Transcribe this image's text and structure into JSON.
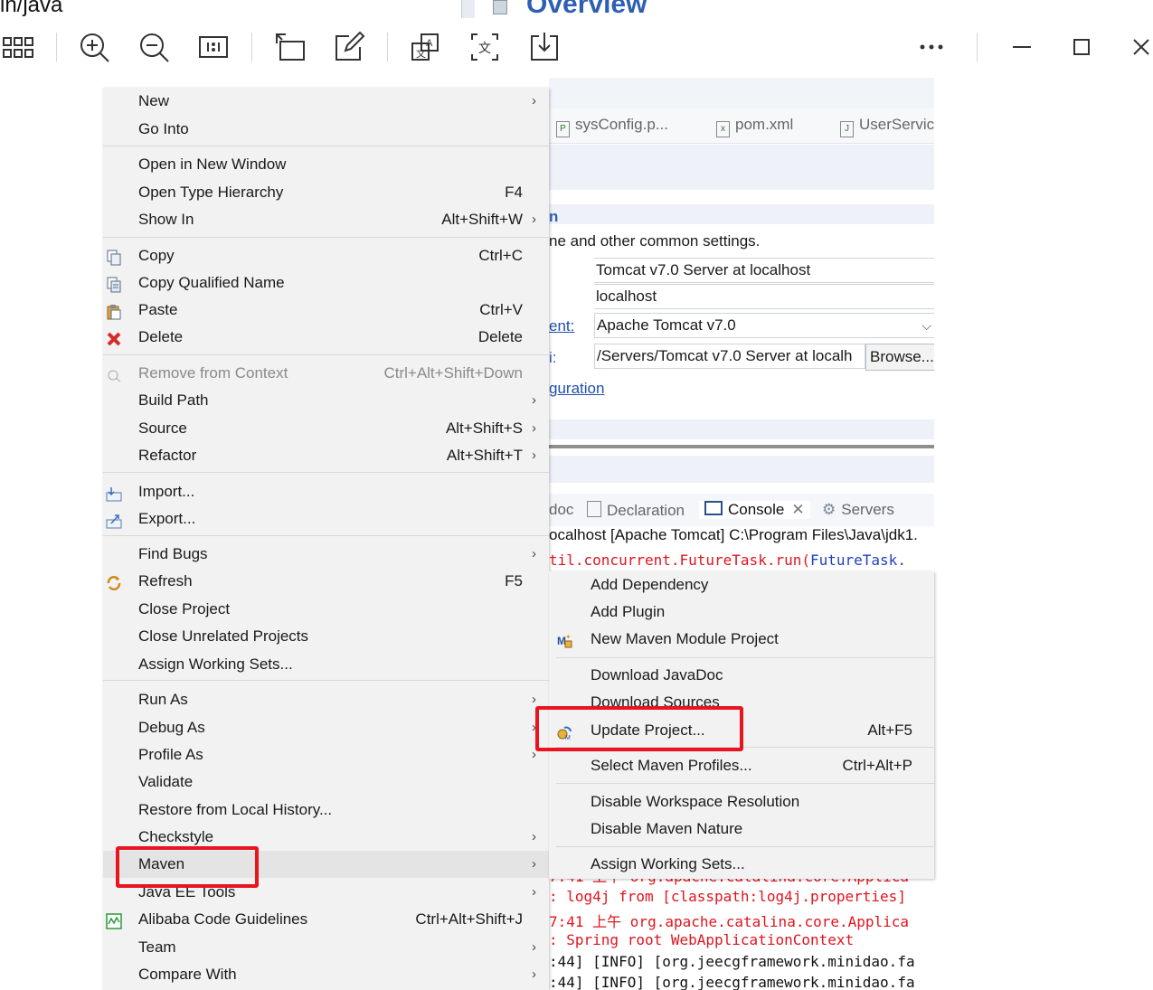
{
  "top": {
    "left_text": "in/java",
    "overview_title": "Overview"
  },
  "toolbar": {
    "buttons": [
      "grid-view",
      "zoom-in",
      "zoom-out",
      "actual-size",
      "rotate",
      "edit",
      "translate-image",
      "ocr",
      "download",
      "more",
      "minimize",
      "maximize",
      "close"
    ]
  },
  "editor_tabs": [
    "sysConfig.p...",
    "pom.xml",
    "UserServic"
  ],
  "server_editor": {
    "section_title": "n",
    "description": "ne and other common settings.",
    "server_name": "Tomcat v7.0 Server at localhost",
    "host_name": "localhost",
    "runtime_label": "ent:",
    "runtime_value": "Apache Tomcat v7.0",
    "config_label": "i:",
    "config_path": "/Servers/Tomcat v7.0 Server at localh",
    "browse_label": "Browse...",
    "config_link": "guration"
  },
  "view_tabs": [
    "doc",
    "Declaration",
    "Console",
    "Servers"
  ],
  "console": {
    "header": "ocalhost [Apache Tomcat] C:\\Program Files\\Java\\jdk1.",
    "line1_pre": "til.concurrent.FutureTask.run(",
    "line1_link": "FutureTask.",
    "lines": [
      "7:41 上午 org.apache.catalina.core.Applica",
      ": log4j from [classpath:log4j.properties]",
      "7:41 上午 org.apache.catalina.core.Applica",
      ": Spring root WebApplicationContext",
      ":44] [INFO] [org.jeecgframework.minidao.fa",
      ":44] [INFO] [org.jeecgframework.minidao.fa"
    ]
  },
  "context_menu": {
    "items": [
      {
        "label": "New",
        "shortcut": "",
        "submenu": true
      },
      {
        "label": "Go Into",
        "shortcut": ""
      },
      {
        "label": "Open in New Window",
        "shortcut": ""
      },
      {
        "label": "Open Type Hierarchy",
        "shortcut": "F4"
      },
      {
        "label": "Show In",
        "shortcut": "Alt+Shift+W",
        "submenu": true
      },
      {
        "label": "Copy",
        "shortcut": "Ctrl+C",
        "icon": "copy-icon"
      },
      {
        "label": "Copy Qualified Name",
        "shortcut": "",
        "icon": "copy-qualified-icon"
      },
      {
        "label": "Paste",
        "shortcut": "Ctrl+V",
        "icon": "paste-icon"
      },
      {
        "label": "Delete",
        "shortcut": "Delete",
        "icon": "delete-icon"
      },
      {
        "label": "Remove from Context",
        "shortcut": "Ctrl+Alt+Shift+Down",
        "disabled": true,
        "icon": "remove-context-icon"
      },
      {
        "label": "Build Path",
        "shortcut": "",
        "submenu": true
      },
      {
        "label": "Source",
        "shortcut": "Alt+Shift+S",
        "submenu": true
      },
      {
        "label": "Refactor",
        "shortcut": "Alt+Shift+T",
        "submenu": true
      },
      {
        "label": "Import...",
        "shortcut": "",
        "icon": "import-icon"
      },
      {
        "label": "Export...",
        "shortcut": "",
        "icon": "export-icon"
      },
      {
        "label": "Find Bugs",
        "shortcut": "",
        "submenu": true
      },
      {
        "label": "Refresh",
        "shortcut": "F5",
        "icon": "refresh-icon"
      },
      {
        "label": "Close Project",
        "shortcut": ""
      },
      {
        "label": "Close Unrelated Projects",
        "shortcut": ""
      },
      {
        "label": "Assign Working Sets...",
        "shortcut": ""
      },
      {
        "label": "Run As",
        "shortcut": "",
        "submenu": true
      },
      {
        "label": "Debug As",
        "shortcut": "",
        "submenu": true
      },
      {
        "label": "Profile As",
        "shortcut": "",
        "submenu": true
      },
      {
        "label": "Validate",
        "shortcut": ""
      },
      {
        "label": "Restore from Local History...",
        "shortcut": ""
      },
      {
        "label": "Checkstyle",
        "shortcut": "",
        "submenu": true
      },
      {
        "label": "Maven",
        "shortcut": "",
        "submenu": true,
        "highlighted": true
      },
      {
        "label": "Java EE Tools",
        "shortcut": "",
        "submenu": true
      },
      {
        "label": "Alibaba Code Guidelines",
        "shortcut": "Ctrl+Alt+Shift+J",
        "icon": "alibaba-icon"
      },
      {
        "label": "Team",
        "shortcut": "",
        "submenu": true
      },
      {
        "label": "Compare With",
        "shortcut": "",
        "submenu": true
      }
    ]
  },
  "maven_submenu": {
    "items": [
      {
        "label": "Add Dependency",
        "shortcut": ""
      },
      {
        "label": "Add Plugin",
        "shortcut": ""
      },
      {
        "label": "New Maven Module Project",
        "shortcut": "",
        "icon": "maven-module-icon"
      },
      {
        "label": "Download JavaDoc",
        "shortcut": ""
      },
      {
        "label": "Download Sources",
        "shortcut": ""
      },
      {
        "label": "Update Project...",
        "shortcut": "Alt+F5",
        "icon": "update-project-icon"
      },
      {
        "label": "Select Maven Profiles...",
        "shortcut": "Ctrl+Alt+P"
      },
      {
        "label": "Disable Workspace Resolution",
        "shortcut": ""
      },
      {
        "label": "Disable Maven Nature",
        "shortcut": ""
      },
      {
        "label": "Assign Working Sets...",
        "shortcut": ""
      }
    ]
  },
  "colors": {
    "highlight_box": "#e8141e",
    "menu_bg": "#f2f2f2",
    "link": "#1f4fb2",
    "console_error": "#e0141e"
  }
}
